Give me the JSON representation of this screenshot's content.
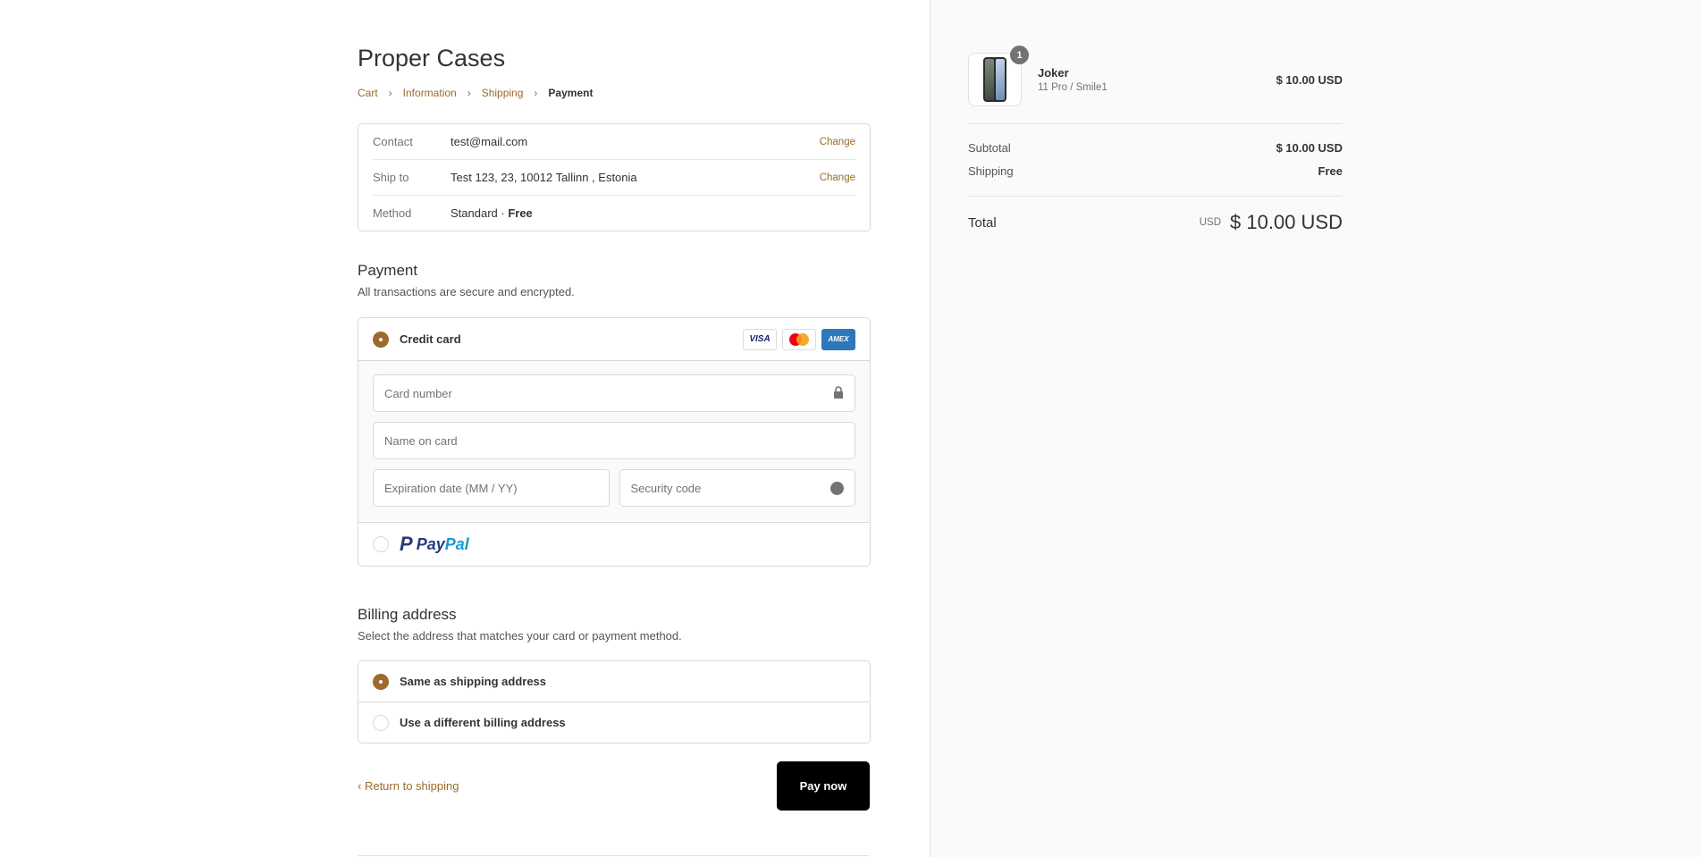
{
  "shop": {
    "title": "Proper Cases"
  },
  "breadcrumb": {
    "cart": "Cart",
    "information": "Information",
    "shipping": "Shipping",
    "payment": "Payment"
  },
  "review": {
    "contact_label": "Contact",
    "contact_value": "test@mail.com",
    "contact_change": "Change",
    "shipto_label": "Ship to",
    "shipto_value": "Test 123, 23, 10012 Tallinn , Estonia",
    "shipto_change": "Change",
    "method_label": "Method",
    "method_name": "Standard · ",
    "method_price": "Free"
  },
  "payment": {
    "title": "Payment",
    "subtitle": "All transactions are secure and encrypted.",
    "credit_card_label": "Credit card",
    "cards": {
      "visa": "VISA",
      "amex": "AMEX"
    },
    "card_number_placeholder": "Card number",
    "name_on_card_placeholder": "Name on card",
    "expiration_placeholder": "Expiration date (MM / YY)",
    "security_code_placeholder": "Security code",
    "security_help": "?",
    "paypal_pay": "Pay",
    "paypal_pal": "Pal",
    "selected": "credit-card"
  },
  "billing": {
    "title": "Billing address",
    "subtitle": "Select the address that matches your card or payment method.",
    "same_label": "Same as shipping address",
    "different_label": "Use a different billing address",
    "selected": "same"
  },
  "actions": {
    "return_label": "Return to shipping",
    "pay_label": "Pay now"
  },
  "summary": {
    "product_name": "Joker",
    "product_variant": "11 Pro / Smile1",
    "product_qty": "1",
    "product_price": "$ 10.00 USD",
    "subtotal_label": "Subtotal",
    "subtotal_value": "$ 10.00 USD",
    "shipping_label": "Shipping",
    "shipping_value": "Free",
    "total_label": "Total",
    "total_currency": "USD",
    "total_value": "$ 10.00 USD"
  },
  "colors": {
    "accent": "#9c6a2c",
    "button": "#000000",
    "sidebar_bg": "#fafafa"
  }
}
